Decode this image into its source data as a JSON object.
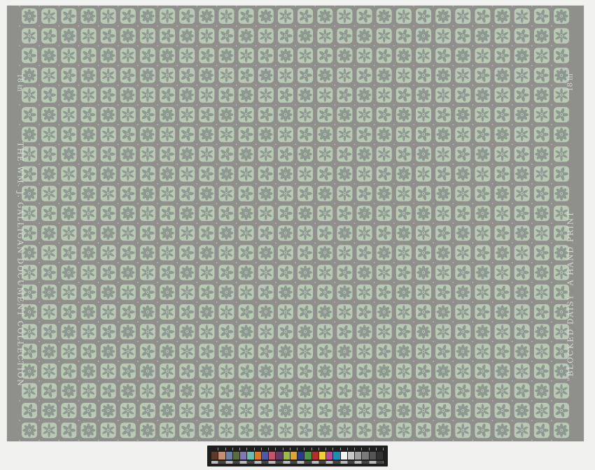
{
  "artwork": {
    "left_edge_text": "The Wm. J. Galligan Document Collection",
    "right_edge_text": "\"Blocked Daisy\" a Hand Print",
    "repeat_mark": "18 in",
    "colors": {
      "ground": "#8f8f8b",
      "tile": "#b9c9b5",
      "motif": "#8e9890",
      "dot": "#d5dfd3"
    },
    "motifs": [
      "daisy-icon",
      "star-flower-icon",
      "pinwheel-icon"
    ]
  },
  "color_target": {
    "swatches": [
      "#5b3a29",
      "#c58d72",
      "#6a82a7",
      "#576c3f",
      "#8477b1",
      "#6bbcb0",
      "#d97a2a",
      "#4c5ba8",
      "#c25566",
      "#5e3c6c",
      "#9dbb43",
      "#e0a630",
      "#2d3b8e",
      "#4c9447",
      "#b12f2f",
      "#eed233",
      "#b84d94",
      "#1f8fb1",
      "#f2f2f2",
      "#c8c8c8",
      "#a0a0a0",
      "#7a7a7a",
      "#555555",
      "#333333"
    ]
  }
}
